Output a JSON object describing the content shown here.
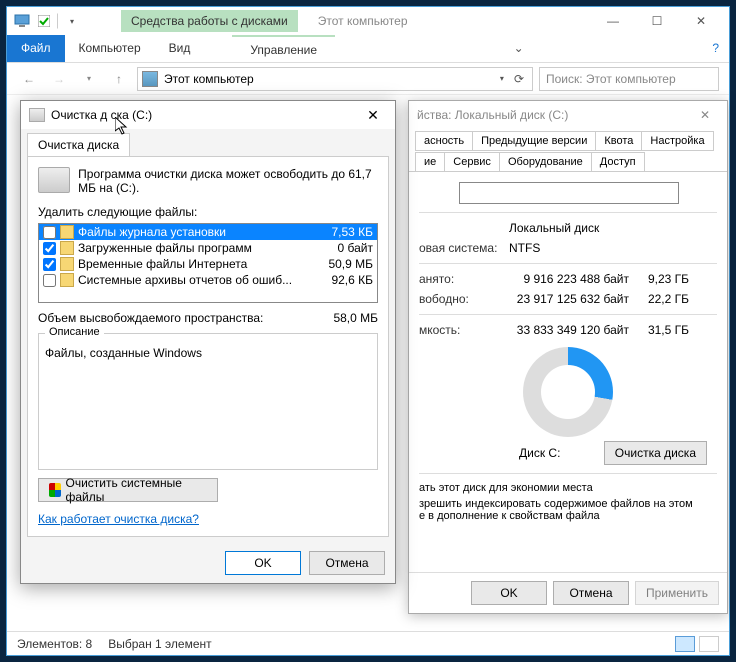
{
  "titlebar": {
    "context_tab": "Средства работы с дисками",
    "window_title": "Этот компьютер"
  },
  "ribbon": {
    "file": "Файл",
    "tabs": [
      "Компьютер",
      "Вид"
    ],
    "context_tab": "Управление"
  },
  "nav": {
    "breadcrumb": "Этот компьютер",
    "search_placeholder": "Поиск: Этот компьютер"
  },
  "statusbar": {
    "items": "Элементов: 8",
    "selected": "Выбран 1 элемент"
  },
  "props": {
    "title": "йства: Локальный диск (C:)",
    "tabs_row1": [
      "асность",
      "Предыдущие версии",
      "Квота",
      "Настройка"
    ],
    "tabs_row2": [
      "ие",
      "Сервис",
      "Оборудование",
      "Доступ"
    ],
    "type_label": "Локальный диск",
    "fs_label": "овая система:",
    "fs_value": "NTFS",
    "used_label": "анято:",
    "used_bytes": "9 916 223 488 байт",
    "used_gb": "9,23 ГБ",
    "free_label": "вободно:",
    "free_bytes": "23 917 125 632 байт",
    "free_gb": "22,2 ГБ",
    "cap_label": "мкость:",
    "cap_bytes": "33 833 349 120 байт",
    "cap_gb": "31,5 ГБ",
    "chart_label": "Диск C:",
    "cleanup_btn": "Очистка диска",
    "compress": "ать этот диск для экономии места",
    "index": "зрешить индексировать содержимое файлов на этом\nе в дополнение к свойствам файла",
    "ok": "OK",
    "cancel": "Отмена",
    "apply": "Применить"
  },
  "cleanup": {
    "title": "Очистка д     ска  (C:)",
    "tab": "Очистка диска",
    "intro": "Программа очистки диска может освободить до 61,7 МБ на  (C:).",
    "list_label": "Удалить следующие файлы:",
    "items": [
      {
        "name": "Файлы журнала установки",
        "size": "7,53 КБ",
        "checked": false,
        "selected": true
      },
      {
        "name": "Загруженные файлы программ",
        "size": "0 байт",
        "checked": true,
        "selected": false
      },
      {
        "name": "Временные файлы Интернета",
        "size": "50,9 МБ",
        "checked": true,
        "selected": false
      },
      {
        "name": "Системные архивы отчетов об ошиб...",
        "size": "92,6 КБ",
        "checked": false,
        "selected": false
      }
    ],
    "freed_label": "Объем высвобождаемого пространства:",
    "freed_value": "58,0 МБ",
    "desc_label": "Описание",
    "desc_text": "Файлы, созданные Windows",
    "sys_btn": "Очистить системные файлы",
    "help_link": "Как работает очистка диска?",
    "ok": "OK",
    "cancel": "Отмена"
  }
}
